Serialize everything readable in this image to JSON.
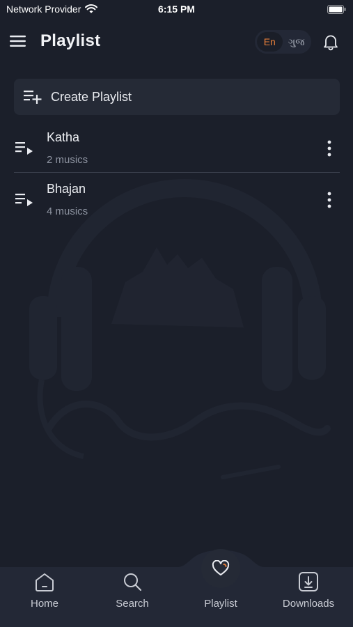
{
  "status_bar": {
    "carrier": "Network Provider",
    "time": "6:15 PM"
  },
  "header": {
    "title": "Playlist",
    "lang_options": [
      "En",
      "ગુજ"
    ],
    "selected_lang": "En",
    "accent_color": "#e9803a"
  },
  "create_playlist": {
    "label": "Create Playlist",
    "icon": "playlist-add-icon"
  },
  "playlists": [
    {
      "title": "Katha",
      "count": "2 musics",
      "icon": "playlist-play-icon"
    },
    {
      "title": "Bhajan",
      "count": "4 musics",
      "icon": "playlist-play-icon"
    }
  ],
  "bottom_nav": {
    "items": [
      {
        "label": "Home",
        "icon": "home-icon"
      },
      {
        "label": "Search",
        "icon": "search-icon"
      },
      {
        "label": "Playlist",
        "icon": "heart-icon"
      },
      {
        "label": "Downloads",
        "icon": "download-icon"
      }
    ],
    "selected": "Playlist"
  },
  "theme": {
    "background": "#1b1f2a",
    "card": "#252a36",
    "muted_text": "#8d93a0"
  }
}
